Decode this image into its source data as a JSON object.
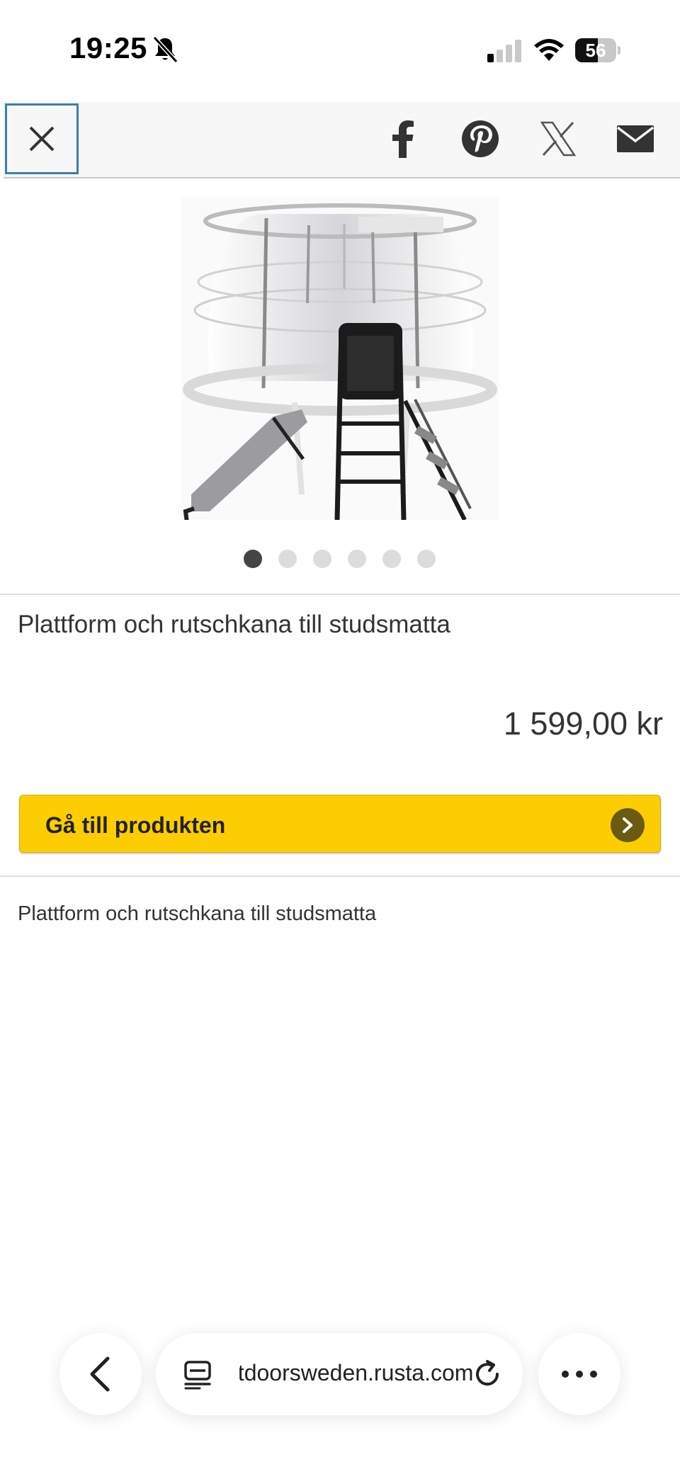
{
  "status_bar": {
    "time": "19:25",
    "battery_level": "56",
    "battery_fraction": 0.56
  },
  "share_bar": {
    "icons": [
      "close-icon",
      "facebook-icon",
      "pinterest-icon",
      "x-icon",
      "email-icon"
    ]
  },
  "carousel": {
    "dots": 6,
    "active_index": 0
  },
  "product": {
    "title": "Plattform och rutschkana till studsmatta",
    "price": "1 599,00 kr",
    "cta_label": "Gå till produkten",
    "description": "Plattform och rutschkana till studsmatta"
  },
  "browser": {
    "url": "utdoorsweden.rusta.com",
    "icons": [
      "back-icon",
      "tabs-icon",
      "reload-icon",
      "more-icon"
    ]
  },
  "colors": {
    "accent_yellow": "#fccd00",
    "focus_outline": "#3d7fb0",
    "text": "#333333"
  }
}
